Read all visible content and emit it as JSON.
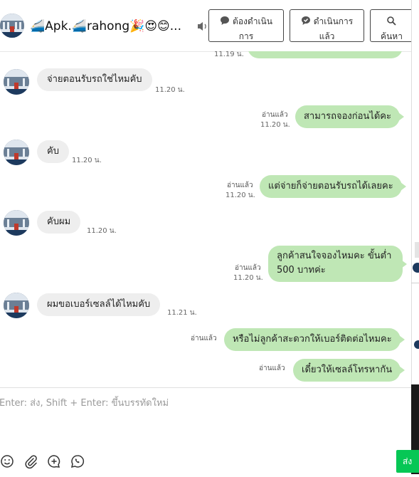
{
  "header": {
    "title": "🚄Apk.🚄rahong🎉😍😊...",
    "buttons": [
      {
        "line1": "ต้องดำเนิน",
        "line2": "การ",
        "icon": "speech-bubble-icon"
      },
      {
        "line1": "ดำเนินการ",
        "line2": "แล้ว",
        "icon": "speech-check-icon"
      },
      {
        "line1": "",
        "line2": "ค้นหา",
        "icon": "search-icon"
      }
    ]
  },
  "messages": {
    "top_partial": {
      "time": "11.19 น.",
      "text": "..."
    },
    "items": [
      {
        "dir": "in",
        "text": "จ่ายตอนรับรถใช่ไหมคับ",
        "time": "11.20 น."
      },
      {
        "dir": "out",
        "read": "อ่านแล้ว",
        "time": "11.20 น.",
        "text": "สามารถจองก่อนได้คะ"
      },
      {
        "dir": "in",
        "text": "คับ",
        "time": "11.20 น."
      },
      {
        "dir": "out",
        "read": "อ่านแล้ว",
        "time": "11.20 น.",
        "text": "แต่จ่ายก็จ่ายตอนรับรถได้เลยคะ"
      },
      {
        "dir": "in",
        "text": "คับผม",
        "time": "11.20 น."
      },
      {
        "dir": "out",
        "read": "อ่านแล้ว",
        "time": "11.20 น.",
        "text": "ลูกค้าสนใจจองไหมคะ ขั้นต่ำ 500 บาทค่ะ"
      },
      {
        "dir": "in",
        "text": "ผมขอเบอร์เซลล์ได้ไหมคับ",
        "time": "11.21 น."
      },
      {
        "dir": "out",
        "read": "อ่านแล้ว",
        "time": "",
        "text": "หรือไม่ลูกค้าสะดวกให้เบอร์ติดต่อไหมคะ"
      },
      {
        "dir": "out",
        "read": "อ่านแล้ว",
        "time": "",
        "text": "เดี๋ยวให้เซลล์โทรหากัน"
      }
    ]
  },
  "composer": {
    "placeholder": "Enter: ส่ง, Shift + Enter: ขึ้นบรรทัดใหม่",
    "send_label": "ส่ง"
  },
  "colors": {
    "outgoing": "#bfe7b5",
    "incoming": "#eeeeee",
    "send": "#06c755"
  }
}
